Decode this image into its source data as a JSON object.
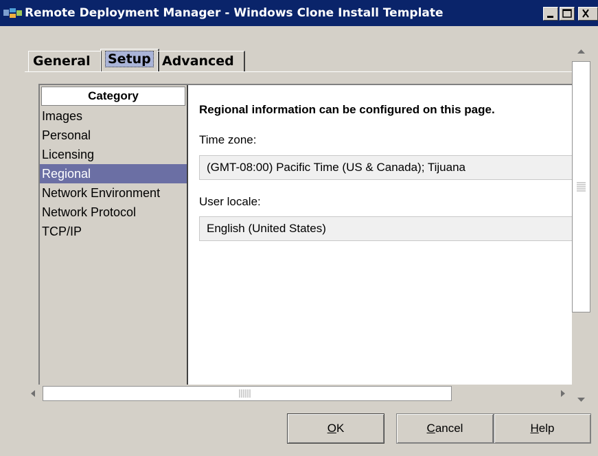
{
  "window": {
    "title": "Remote Deployment Manager - Windows Clone Install Template",
    "controls": {
      "minimize": "_",
      "maximize": "□",
      "close": "X"
    }
  },
  "tabs": [
    {
      "label": "General",
      "selected": false
    },
    {
      "label": "Setup",
      "selected": true
    },
    {
      "label": "Advanced",
      "selected": false
    }
  ],
  "category": {
    "header": "Category",
    "items": [
      "Images",
      "Personal",
      "Licensing",
      "Regional",
      "Network Environment",
      "Network Protocol",
      "TCP/IP"
    ],
    "selected": "Regional"
  },
  "content": {
    "info": "Regional information can be configured on this page.",
    "time_zone_label": "Time zone:",
    "time_zone_value": "(GMT-08:00) Pacific Time (US & Canada); Tijuana",
    "user_locale_label": "User locale:",
    "user_locale_value": "English (United States)"
  },
  "buttons": {
    "ok_mnemonic": "O",
    "ok_rest": "K",
    "cancel_mnemonic": "C",
    "cancel_rest": "ancel",
    "help_mnemonic": "H",
    "help_rest": "elp"
  },
  "colors": {
    "titlebar": "#0a246a",
    "face": "#d4d0c8",
    "selection": "#6b6fa4",
    "tab_highlight": "#aab4d8"
  }
}
